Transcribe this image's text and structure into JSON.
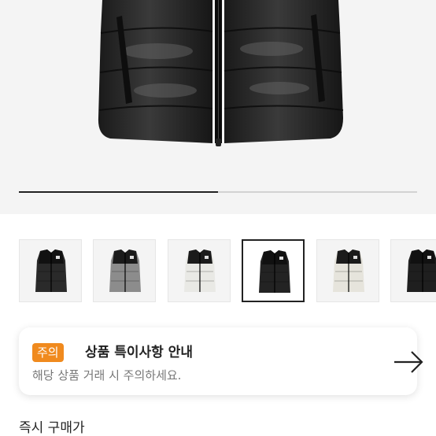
{
  "product": {
    "image_alt": "black padded vest",
    "gallery_progress": 0.5
  },
  "thumbnails": [
    {
      "name": "thumb-black-vest-1",
      "body_color": "#2a2a2a",
      "yoke_color": "#111"
    },
    {
      "name": "thumb-grey-vest",
      "body_color": "#8c8c8c",
      "yoke_color": "#1b1b1b"
    },
    {
      "name": "thumb-white-vest",
      "body_color": "#e9e9e5",
      "yoke_color": "#1b1b1b"
    },
    {
      "name": "thumb-black-vest-2",
      "body_color": "#232323",
      "yoke_color": "#111",
      "selected": true
    },
    {
      "name": "thumb-cream-vest",
      "body_color": "#e6e4dc",
      "yoke_color": "#1b1b1b"
    },
    {
      "name": "thumb-black-vest-3",
      "body_color": "#1f1f1f",
      "yoke_color": "#111"
    }
  ],
  "notice": {
    "badge": "주의",
    "title": "상품 특이사항 안내",
    "subtitle": "해당 상품 거래 시 주의하세요.",
    "badge_color": "#f08a1e",
    "arrow_icon": "arrow-right-icon"
  },
  "section": {
    "label": "즉시 구매가"
  }
}
